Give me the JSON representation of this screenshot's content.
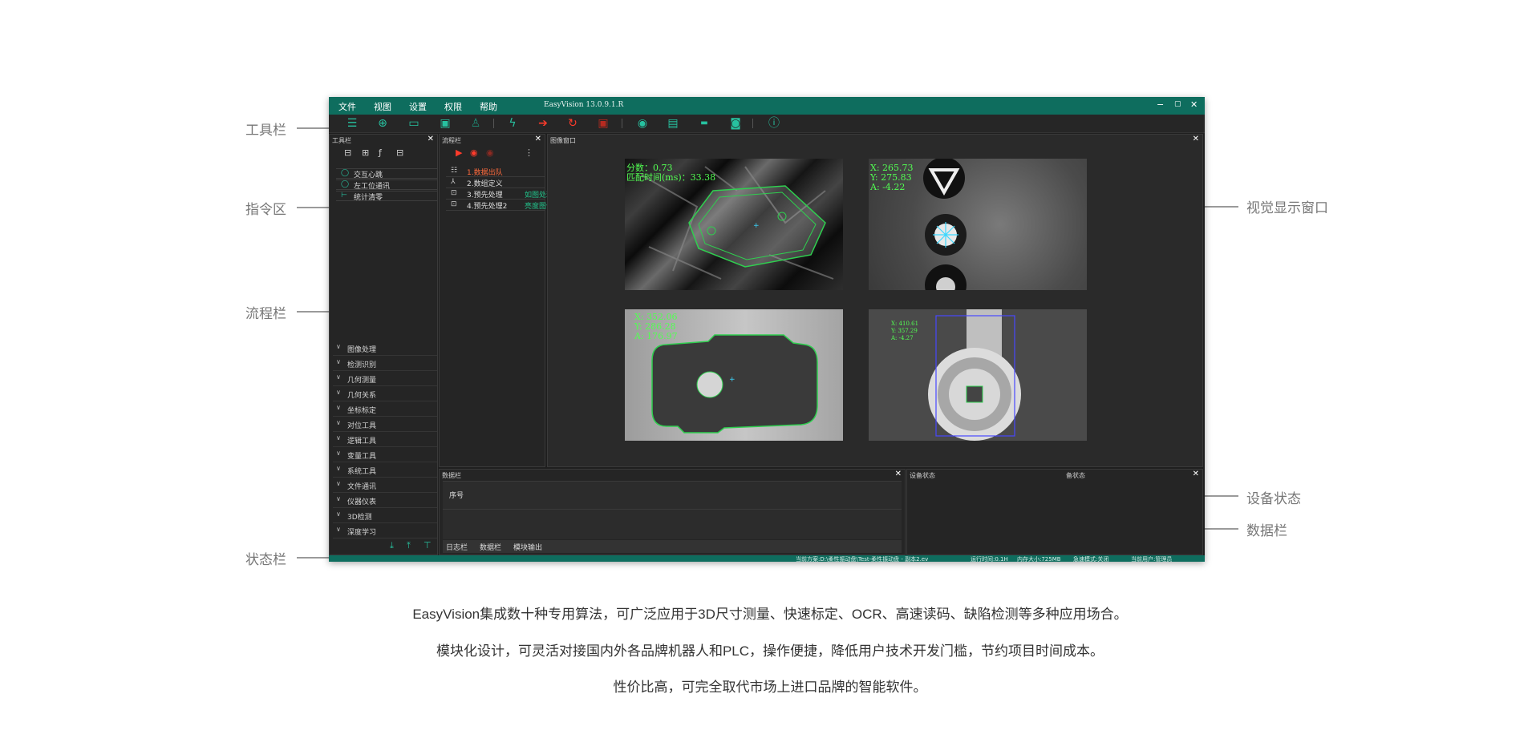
{
  "callouts": {
    "toolbar": "工具栏",
    "command_area": "指令区",
    "flow_bar": "流程栏",
    "status_bar": "状态栏",
    "vision_window": "视觉显示窗口",
    "device_status": "设备状态",
    "data_bar": "数据栏"
  },
  "menubar": {
    "items": [
      "文件",
      "视图",
      "设置",
      "权限",
      "帮助"
    ],
    "title": "EasyVision 13.0.9.1.R",
    "controls": [
      "−",
      "▢",
      "✕"
    ]
  },
  "toolbar_icons": [
    "list-icon",
    "new-file-icon",
    "open-folder-icon",
    "save-icon",
    "user-icon",
    "flash-icon",
    "run-arrow-icon",
    "loop-icon",
    "stop-icon",
    "camera-icon",
    "calibrate-icon",
    "barcode-icon",
    "module-icon",
    "info-icon"
  ],
  "tool_panel": {
    "title": "工具栏",
    "commands": [
      "交互心跳",
      "左工位通讯",
      "统计清零"
    ],
    "categories": [
      "图像处理",
      "检测识别",
      "几何测量",
      "几何关系",
      "坐标标定",
      "对位工具",
      "逻辑工具",
      "变量工具",
      "系统工具",
      "文件通讯",
      "仪器仪表",
      "3D检测",
      "深度学习"
    ]
  },
  "flow_panel": {
    "title": "流程栏",
    "rows": [
      {
        "label": "1.数据出队",
        "tag": ""
      },
      {
        "label": "2.数组定义",
        "tag": ""
      },
      {
        "label": "3.预先处理",
        "tag": "如图处理"
      },
      {
        "label": "4.预先处理2",
        "tag": "亮度图像"
      }
    ]
  },
  "image_window": {
    "title": "图像窗口",
    "img1": {
      "line1": "分数：0.73",
      "line2": "匹配时间(ms)：33.38"
    },
    "img2": {
      "x": "X: 265.73",
      "y": "Y: 275.83",
      "a": "A: -4.22"
    },
    "img3": {
      "x": "X: 352.06",
      "y": "Y: 286.28",
      "a": "A: 176.97"
    },
    "img4": {
      "x": "X: 410.61",
      "y": "Y: 357.29",
      "a": "A: -4.27"
    }
  },
  "data_panel": {
    "title": "数据栏",
    "column": "序号",
    "tabs": [
      "日志栏",
      "数据栏",
      "模块输出"
    ]
  },
  "device_panel": {
    "title": "设备状态",
    "subtitle": "备状态"
  },
  "statusbar": {
    "items": [
      "当前方案:D:\\柔性振动盘\\Test-柔性振动盘 - 副本2.ev",
      "运行时间:0.1H",
      "内存大小:725MB",
      "急速模式:关闭",
      "当前用户:管理员"
    ]
  },
  "descriptions": [
    "EasyVision集成数十种专用算法，可广泛应用于3D尺寸测量、快速标定、OCR、高速读码、缺陷检测等多种应用场合。",
    "模块化设计，可灵活对接国内外各品牌机器人和PLC，操作便捷，降低用户技术开发门槛，节约项目时间成本。",
    "性价比高，可完全取代市场上进口品牌的智能软件。"
  ],
  "colors": {
    "brand": "#0e6d5e",
    "accent": "#27c2a0",
    "overlay": "#52ff52"
  }
}
